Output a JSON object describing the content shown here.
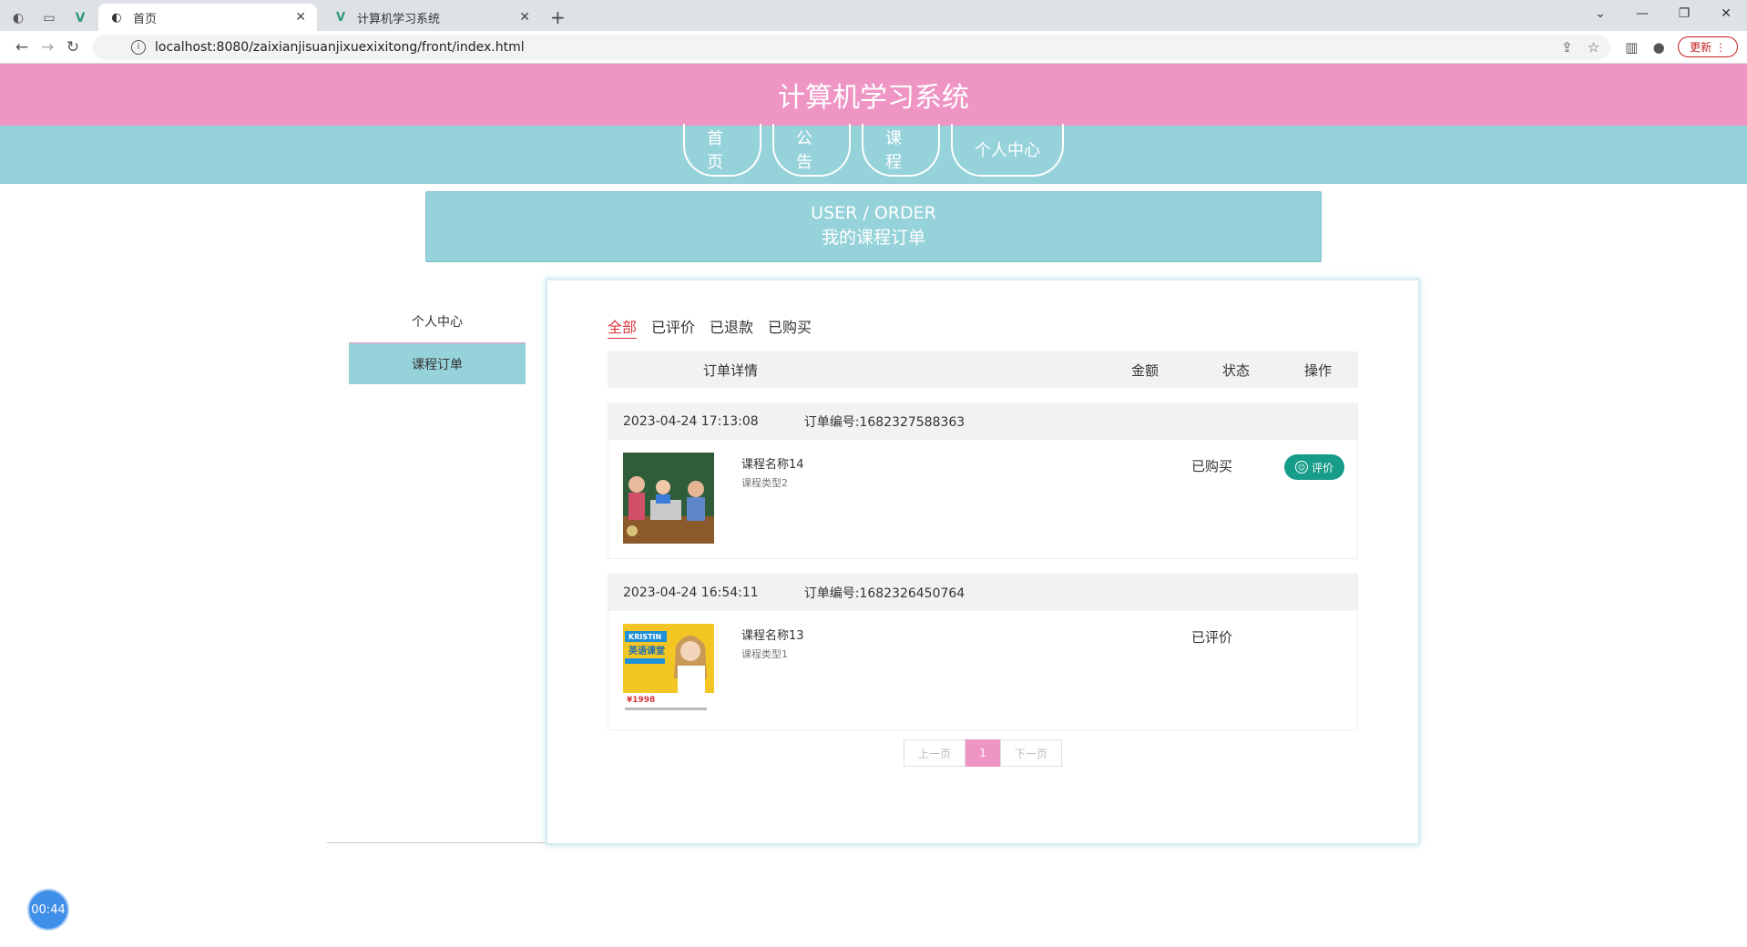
{
  "browser": {
    "tabs": [
      {
        "title": "首页",
        "active": true
      },
      {
        "title": "计算机学习系统",
        "active": false
      }
    ],
    "url": "localhost:8080/zaixianjisuanjixuexixitong/front/index.html",
    "update_label": "更新"
  },
  "site": {
    "title": "计算机学习系统",
    "nav": [
      "首页",
      "公告",
      "课程",
      "个人中心"
    ]
  },
  "banner": {
    "en": "USER / ORDER",
    "zh": "我的课程订单"
  },
  "sidebar": {
    "items": [
      "个人中心",
      "课程订单"
    ]
  },
  "filters": [
    "全部",
    "已评价",
    "已退款",
    "已购买"
  ],
  "table_headers": [
    "订单详情",
    "金额",
    "状态",
    "操作"
  ],
  "orders": [
    {
      "time": "2023-04-24 17:13:08",
      "order_no": "订单编号:1682327588363",
      "course_name": "课程名称14",
      "course_type": "课程类型2",
      "status": "已购买",
      "action": "评价"
    },
    {
      "time": "2023-04-24 16:54:11",
      "order_no": "订单编号:1682326450764",
      "course_name": "课程名称13",
      "course_type": "课程类型1",
      "status": "已评价",
      "thumb_text": {
        "brand": "KRISTIN",
        "title": "英语课堂",
        "price": "¥1998"
      }
    }
  ],
  "pager": {
    "prev": "上一页",
    "current": "1",
    "next": "下一页"
  },
  "timer": "00:44",
  "colors": {
    "pink": "#ee95c3",
    "teal": "#96d2da",
    "green_btn": "#169c88"
  }
}
